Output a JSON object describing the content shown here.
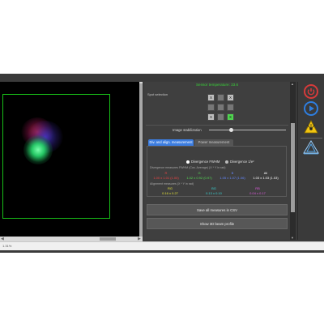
{
  "window": {
    "title": "CinBeamScope – Beam Analyzer – v.1.06"
  },
  "viewer": {
    "zoom_label": "1.31%"
  },
  "sensor": {
    "temperature": "Sensor temperature: 33.6"
  },
  "spot": {
    "label": "Spot selection",
    "cells": [
      "X",
      "",
      "X",
      "",
      "",
      "",
      "X",
      "",
      "X"
    ],
    "selected_index": 8
  },
  "stabilization": {
    "label": "Image stabilization",
    "level": 0.28
  },
  "tabs": {
    "active": "Div. and align. measurement",
    "other": "Power measurement"
  },
  "radio": {
    "option1": "Divergence FWHM",
    "option2": "Divergence 1/e²",
    "selected": "option1"
  },
  "divergence": {
    "caption": "Divergence measures FWHM (Cos. Average) (X * Y in rad)",
    "cols": [
      {
        "name": "R",
        "value": "1.00 x 1.01 (1.00)",
        "color": "#ee4444"
      },
      {
        "name": "G",
        "value": "1.02 x 0.92 (0.97)",
        "color": "#55dd55"
      },
      {
        "name": "B",
        "value": "1.05 x 1.07 (1.06)",
        "color": "#6688ff"
      },
      {
        "name": "All",
        "value": "1.03 x 1.03 (1.03)",
        "color": "#ffffff"
      }
    ]
  },
  "alignment": {
    "caption": "Alignment measures (X * Y in rad)",
    "cols": [
      {
        "name": "RG",
        "value": "0.16 x 0.27",
        "color": "#e3e33a"
      },
      {
        "name": "BG",
        "value": "0.13 x 0.10",
        "color": "#39d5d5"
      },
      {
        "name": "RB",
        "value": "0.04 x 0.17",
        "color": "#e05ae0"
      }
    ]
  },
  "buttons": {
    "save_csv": "Save all measures in CSV",
    "show_3d": "Show 3D beam profile"
  },
  "toolbar": {
    "stop": "stop-icon",
    "play": "play-icon",
    "laser": "laser-warning-icon",
    "logo": "logo-icon"
  }
}
